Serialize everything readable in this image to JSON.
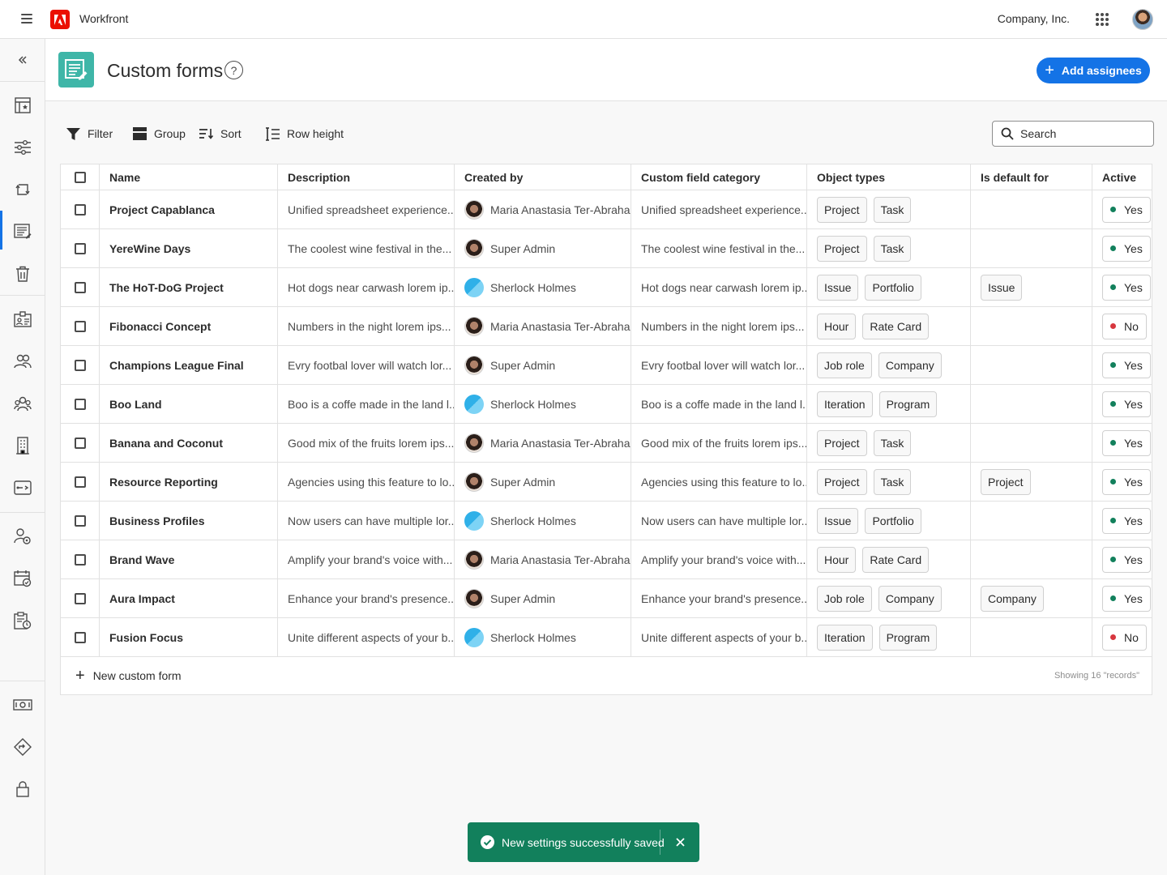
{
  "topbar": {
    "app_name": "Workfront",
    "company": "Company, Inc."
  },
  "sidebar": {
    "items": [
      {
        "icon": "collapse-icon"
      },
      {
        "icon": "home-dashboard-icon"
      },
      {
        "icon": "settings-sliders-icon"
      },
      {
        "icon": "workflow-icon"
      },
      {
        "icon": "custom-forms-icon",
        "active": true
      },
      {
        "icon": "trash-icon"
      },
      {
        "icon": "id-card-icon"
      },
      {
        "icon": "people-icon"
      },
      {
        "icon": "teams-icon"
      },
      {
        "icon": "building-icon"
      },
      {
        "icon": "routing-icon"
      },
      {
        "icon": "user-settings-icon"
      },
      {
        "icon": "calendar-check-icon"
      },
      {
        "icon": "clipboard-clock-icon"
      },
      {
        "icon": "money-icon"
      },
      {
        "icon": "diamond-route-icon"
      },
      {
        "icon": "lock-icon"
      }
    ]
  },
  "header": {
    "title": "Custom forms",
    "help": "?",
    "add_button": "Add assignees"
  },
  "toolbar": {
    "filter": "Filter",
    "group": "Group",
    "sort": "Sort",
    "row_height": "Row height",
    "search_placeholder": "Search"
  },
  "table": {
    "columns": [
      "Name",
      "Description",
      "Created by",
      "Custom field category",
      "Object types",
      "Is default for",
      "Active"
    ],
    "rows": [
      {
        "name": "Project Capablanca",
        "description": "Unified spreadsheet experience...",
        "created_by": "Maria Anastasia Ter-Abraha...",
        "avatar": "photo",
        "category": "Unified spreadsheet experience...",
        "object_types": [
          "Project",
          "Task"
        ],
        "default_for": "",
        "active": "Yes"
      },
      {
        "name": "YereWine Days",
        "description": "The coolest wine festival in the...",
        "created_by": "Super Admin",
        "avatar": "photo",
        "category": "The coolest wine festival in the...",
        "object_types": [
          "Project",
          "Task"
        ],
        "default_for": "",
        "active": "Yes"
      },
      {
        "name": "The HoT-DoG Project",
        "description": "Hot dogs near carwash lorem ip...",
        "created_by": "Sherlock Holmes",
        "avatar": "blue",
        "category": "Hot dogs near carwash lorem ip...",
        "object_types": [
          "Issue",
          "Portfolio"
        ],
        "default_for": "Issue",
        "active": "Yes"
      },
      {
        "name": "Fibonacci Concept",
        "description": "Numbers in the night lorem ips...",
        "created_by": "Maria Anastasia Ter-Abraha...",
        "avatar": "photo",
        "category": "Numbers in the night lorem ips...",
        "object_types": [
          "Hour",
          "Rate Card"
        ],
        "default_for": "",
        "active": "No"
      },
      {
        "name": "Champions League Final",
        "description": "Evry footbal lover will watch lor...",
        "created_by": "Super Admin",
        "avatar": "photo",
        "category": "Evry footbal lover will watch lor...",
        "object_types": [
          "Job role",
          "Company"
        ],
        "default_for": "",
        "active": "Yes"
      },
      {
        "name": "Boo Land",
        "description": "Boo is a coffe made in the land l...",
        "created_by": "Sherlock Holmes",
        "avatar": "blue",
        "category": "Boo is a coffe made in the land l...",
        "object_types": [
          "Iteration",
          "Program"
        ],
        "default_for": "",
        "active": "Yes"
      },
      {
        "name": "Banana and Coconut",
        "description": "Good mix of the fruits lorem ips...",
        "created_by": "Maria Anastasia Ter-Abraha...",
        "avatar": "photo",
        "category": "Good mix of the fruits lorem ips...",
        "object_types": [
          "Project",
          "Task"
        ],
        "default_for": "",
        "active": "Yes"
      },
      {
        "name": "Resource Reporting",
        "description": "Agencies using this feature to lo...",
        "created_by": "Super Admin",
        "avatar": "photo",
        "category": "Agencies using this feature to lo...",
        "object_types": [
          "Project",
          "Task"
        ],
        "default_for": "Project",
        "active": "Yes"
      },
      {
        "name": "Business Profiles",
        "description": "Now users can have multiple lor...",
        "created_by": "Sherlock Holmes",
        "avatar": "blue",
        "category": "Now users can have multiple lor...",
        "object_types": [
          "Issue",
          "Portfolio"
        ],
        "default_for": "",
        "active": "Yes"
      },
      {
        "name": "Brand Wave",
        "description": "Amplify your brand's voice with...",
        "created_by": "Maria Anastasia Ter-Abraha...",
        "avatar": "photo",
        "category": "Amplify your brand's voice with...",
        "object_types": [
          "Hour",
          "Rate Card"
        ],
        "default_for": "",
        "active": "Yes"
      },
      {
        "name": "Aura Impact",
        "description": "Enhance your brand's presence...",
        "created_by": "Super Admin",
        "avatar": "photo",
        "category": "Enhance your brand's presence...",
        "object_types": [
          "Job role",
          "Company"
        ],
        "default_for": "Company",
        "active": "Yes"
      },
      {
        "name": "Fusion Focus",
        "description": "Unite different aspects of your b...",
        "created_by": "Sherlock Holmes",
        "avatar": "blue",
        "category": "Unite different aspects of your b...",
        "object_types": [
          "Iteration",
          "Program"
        ],
        "default_for": "",
        "active": "No"
      }
    ],
    "new_row_label": "New custom form",
    "showing": "Showing 16 \"records\""
  },
  "toast": {
    "message": "New settings successfully saved"
  },
  "colors": {
    "accent": "#1473e6",
    "active_yes": "#12805c",
    "active_no": "#d7373f",
    "toast_bg": "#12805c",
    "page_icon_bg": "#3fb6a8"
  }
}
